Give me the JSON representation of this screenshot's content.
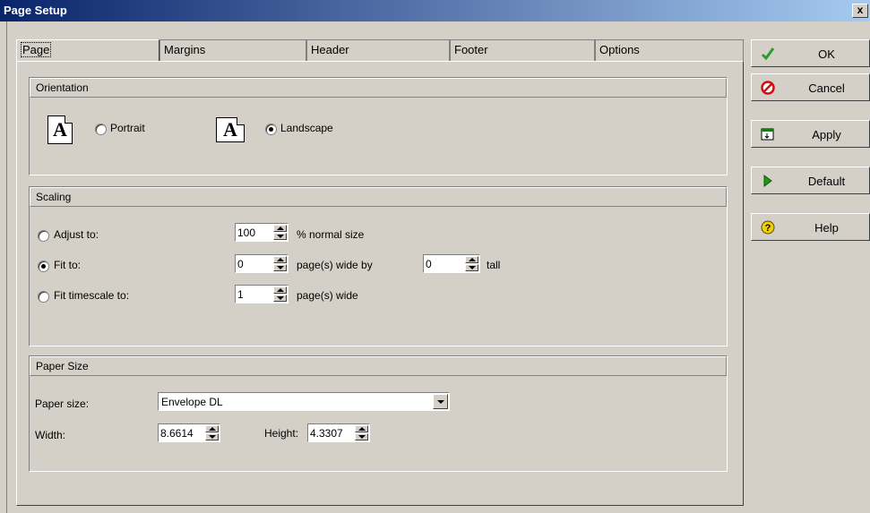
{
  "window": {
    "title": "Page Setup",
    "close_label": "x"
  },
  "tabs": [
    {
      "label": "Page",
      "active": true
    },
    {
      "label": "Margins",
      "active": false
    },
    {
      "label": "Header",
      "active": false
    },
    {
      "label": "Footer",
      "active": false
    },
    {
      "label": "Options",
      "active": false
    }
  ],
  "orientation": {
    "header": "Orientation",
    "portrait_label": "Portrait",
    "landscape_label": "Landscape",
    "icon_glyph": "A",
    "selected": "landscape"
  },
  "scaling": {
    "header": "Scaling",
    "adjust_label": "Adjust to:",
    "adjust_value": "100",
    "adjust_suffix": "% normal size",
    "fit_label": "Fit to:",
    "fit_wide_value": "0",
    "fit_wide_suffix": "page(s) wide by",
    "fit_tall_value": "0",
    "fit_tall_suffix": "tall",
    "timescale_label": "Fit timescale to:",
    "timescale_value": "1",
    "timescale_suffix": "page(s) wide",
    "selected": "fit"
  },
  "paper": {
    "header": "Paper Size",
    "size_label": "Paper size:",
    "size_value": "Envelope DL",
    "width_label": "Width:",
    "width_value": "8.6614",
    "height_label": "Height:",
    "height_value": "4.3307"
  },
  "buttons": {
    "ok": "OK",
    "cancel": "Cancel",
    "apply": "Apply",
    "default": "Default",
    "help": "Help"
  },
  "colors": {
    "titlebar_start": "#0a246a",
    "titlebar_end": "#a6caf0",
    "face": "#d4d0c8",
    "ok_check": "#2e9a2e",
    "cancel_red": "#d01010",
    "default_green": "#1a9a1a",
    "help_yellow": "#f0d000"
  },
  "icons": {
    "ok": "checkmark-icon",
    "cancel": "no-entry-icon",
    "apply": "apply-icon",
    "default": "play-triangle-icon",
    "help": "question-icon"
  }
}
